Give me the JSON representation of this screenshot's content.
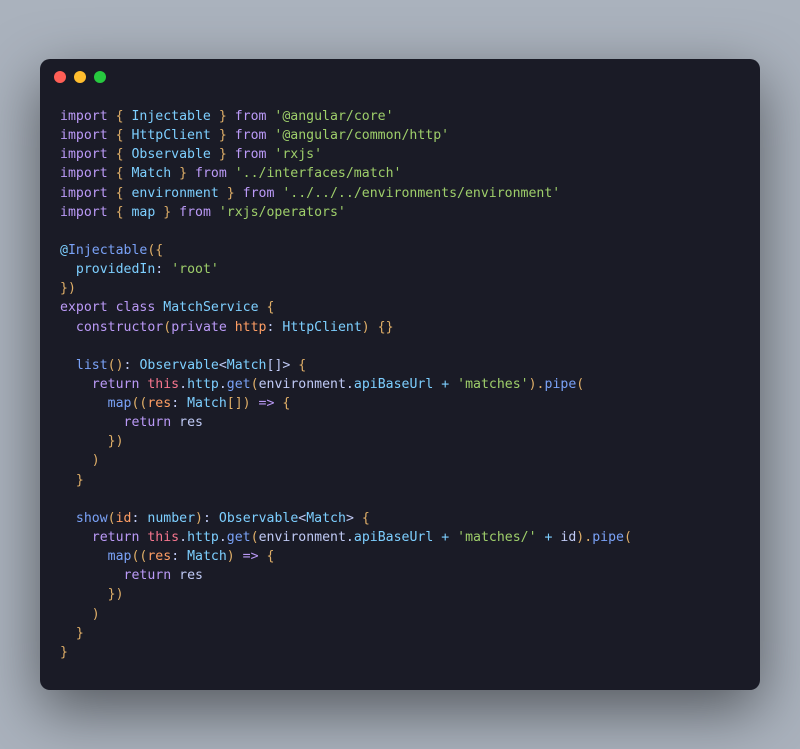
{
  "code": {
    "l1": {
      "kw1": "import",
      "br1": " { ",
      "sym": "Injectable",
      "br2": " } ",
      "kw2": "from",
      "sp": " ",
      "str": "'@angular/core'"
    },
    "l2": {
      "kw1": "import",
      "br1": " { ",
      "sym": "HttpClient",
      "br2": " } ",
      "kw2": "from",
      "sp": " ",
      "str": "'@angular/common/http'"
    },
    "l3": {
      "kw1": "import",
      "br1": " { ",
      "sym": "Observable",
      "br2": " } ",
      "kw2": "from",
      "sp": " ",
      "str": "'rxjs'"
    },
    "l4": {
      "kw1": "import",
      "br1": " { ",
      "sym": "Match",
      "br2": " } ",
      "kw2": "from",
      "sp": " ",
      "str": "'../interfaces/match'"
    },
    "l5": {
      "kw1": "import",
      "br1": " { ",
      "sym": "environment",
      "br2": " } ",
      "kw2": "from",
      "sp": " ",
      "str": "'../../../environments/environment'"
    },
    "l6": {
      "kw1": "import",
      "br1": " { ",
      "sym": "map",
      "br2": " } ",
      "kw2": "from",
      "sp": " ",
      "str": "'rxjs/operators'"
    },
    "l8": {
      "at": "@",
      "dec": "Injectable",
      "open": "({"
    },
    "l9": {
      "ind": "  ",
      "key": "providedIn",
      "colon": ": ",
      "val": "'root'"
    },
    "l10": {
      "close": "})"
    },
    "l11": {
      "kw1": "export",
      "sp1": " ",
      "kw2": "class",
      "sp2": " ",
      "name": "MatchService",
      "sp3": " ",
      "open": "{"
    },
    "l12": {
      "ind": "  ",
      "ctor": "constructor",
      "open": "(",
      "priv": "private",
      "sp": " ",
      "arg": "http",
      "colon": ": ",
      "type": "HttpClient",
      "close": ") {}"
    },
    "l14": {
      "ind": "  ",
      "fn": "list",
      "parens": "()",
      "colon": ": ",
      "type1": "Observable",
      "lt": "<",
      "type2": "Match",
      "arr": "[]>",
      "sp": " ",
      "open": "{"
    },
    "l15": {
      "ind": "    ",
      "ret": "return",
      "sp1": " ",
      "this": "this",
      "dot1": ".",
      "prop": "http",
      "dot2": ".",
      "get": "get",
      "open": "(",
      "env": "environment",
      "dot3": ".",
      "api": "apiBaseUrl",
      "sp2": " ",
      "plus": "+",
      "sp3": " ",
      "str": "'matches'",
      "close": ").",
      "pipe": "pipe",
      "open2": "("
    },
    "l16": {
      "ind": "      ",
      "map": "map",
      "open": "((",
      "res": "res",
      "colon": ": ",
      "type": "Match",
      "arr": "[]) ",
      "arrow": "=>",
      "sp": " ",
      "open2": "{"
    },
    "l17": {
      "ind": "        ",
      "ret": "return",
      "sp": " ",
      "res": "res"
    },
    "l18": {
      "ind": "      ",
      "close": "})"
    },
    "l19": {
      "ind": "    ",
      "close": ")"
    },
    "l20": {
      "ind": "  ",
      "close": "}"
    },
    "l22": {
      "ind": "  ",
      "fn": "show",
      "open": "(",
      "arg": "id",
      "colon": ": ",
      "argtype": "number",
      "close": ")",
      "colon2": ": ",
      "type1": "Observable",
      "lt": "<",
      "type2": "Match",
      "gt": ">",
      "sp": " ",
      "open2": "{"
    },
    "l23": {
      "ind": "    ",
      "ret": "return",
      "sp1": " ",
      "this": "this",
      "dot1": ".",
      "prop": "http",
      "dot2": ".",
      "get": "get",
      "open": "(",
      "env": "environment",
      "dot3": ".",
      "api": "apiBaseUrl",
      "sp2": " ",
      "plus": "+",
      "sp3": " ",
      "str": "'matches/'",
      "sp4": " ",
      "plus2": "+",
      "sp5": " ",
      "id": "id",
      "close": ").",
      "pipe": "pipe",
      "open2": "("
    },
    "l24": {
      "ind": "      ",
      "map": "map",
      "open": "((",
      "res": "res",
      "colon": ": ",
      "type": "Match",
      "close": ") ",
      "arrow": "=>",
      "sp": " ",
      "open2": "{"
    },
    "l25": {
      "ind": "        ",
      "ret": "return",
      "sp": " ",
      "res": "res"
    },
    "l26": {
      "ind": "      ",
      "close": "})"
    },
    "l27": {
      "ind": "    ",
      "close": ")"
    },
    "l28": {
      "ind": "  ",
      "close": "}"
    },
    "l29": {
      "close": "}"
    }
  }
}
